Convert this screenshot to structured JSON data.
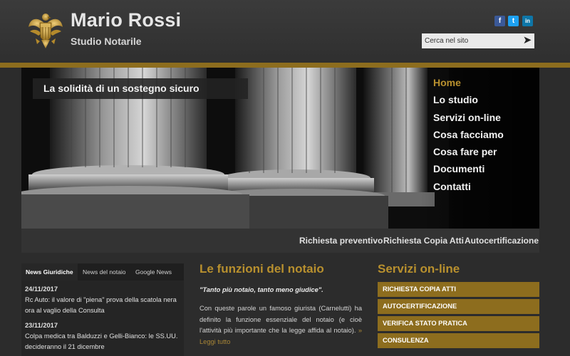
{
  "header": {
    "title": "Mario Rossi",
    "subtitle": "Studio Notarile",
    "logo_icon": "eagle-seal-icon",
    "social": [
      {
        "icon": "facebook-icon",
        "glyph": "f"
      },
      {
        "icon": "twitter-icon",
        "glyph": "t"
      },
      {
        "icon": "linkedin-icon",
        "glyph": "in"
      }
    ],
    "search": {
      "placeholder": "Cerca nel sito",
      "button_glyph": "➤"
    }
  },
  "hero": {
    "tagline": "La solidità di un sostegno sicuro",
    "nav": [
      {
        "label": "Home",
        "active": true
      },
      {
        "label": "Lo studio"
      },
      {
        "label": "Servizi on-line"
      },
      {
        "label": "Cosa facciamo"
      },
      {
        "label": "Cosa fare per"
      },
      {
        "label": "Documenti"
      },
      {
        "label": "Contatti"
      }
    ]
  },
  "subnav": [
    "Richiesta preventivo",
    "Richiesta Copia Atti",
    "Autocertificazione"
  ],
  "news": {
    "tabs": [
      "News Giuridiche",
      "News del notaio",
      "Google News"
    ],
    "items": [
      {
        "date": "24/11/2017",
        "text": "Rc Auto: il valore di \"piena\" prova della scatola nera ora al vaglio della Consulta"
      },
      {
        "date": "23/11/2017",
        "text": "Colpa medica tra Balduzzi e Gelli-Bianco: le SS.UU. decideranno il 21 dicembre"
      }
    ]
  },
  "funzioni": {
    "title": "Le funzioni del notaio",
    "quote": "\"Tanto più notaio, tanto meno giudice\".",
    "body": "Con queste parole un famoso giurista (Carnelutti) ha definito la funzione essenziale del notaio (e cioè l'attività più importante che la legge affida al notaio).",
    "more": "» Leggi tutto"
  },
  "servizi": {
    "title": "Servizi on-line",
    "items": [
      "RICHIESTA COPIA ATTI",
      "AUTOCERTIFICAZIONE",
      "VERIFICA STATO PRATICA",
      "CONSULENZA"
    ]
  },
  "colors": {
    "accent": "#8d6d1e",
    "accent_text": "#b8902e",
    "background": "#2c2c2c"
  }
}
